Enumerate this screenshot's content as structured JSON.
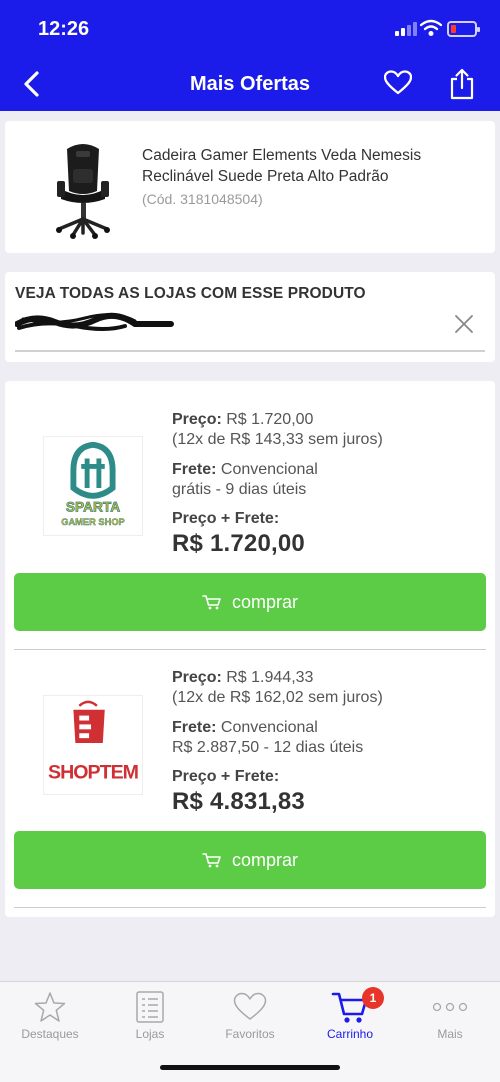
{
  "status_bar": {
    "time": "12:26"
  },
  "navbar": {
    "title": "Mais Ofertas"
  },
  "product": {
    "name": "Cadeira Gamer Elements Veda Nemesis Reclinável Suede Preta Alto Padrão",
    "code": "(Cód. 3181048504)"
  },
  "stores": {
    "title": "VEJA TODAS AS LOJAS COM ESSE PRODUTO"
  },
  "offers": [
    {
      "store_logo_text": [
        "SPARTA",
        "GAMER SHOP"
      ],
      "price_label": "Preço:",
      "price": "R$ 1.720,00",
      "installments": "(12x de R$ 143,33 sem juros)",
      "shipping_label": "Frete:",
      "shipping_type": "Convencional",
      "shipping_detail": "grátis - 9 dias úteis",
      "total_label": "Preço + Frete:",
      "total": "R$ 1.720,00",
      "buy_label": "comprar"
    },
    {
      "store_logo_text": [
        "SHOPTEM"
      ],
      "price_label": "Preço:",
      "price": "R$ 1.944,33",
      "installments": "(12x de R$ 162,02 sem juros)",
      "shipping_label": "Frete:",
      "shipping_type": "Convencional",
      "shipping_detail": "R$ 2.887,50 - 12 dias úteis",
      "total_label": "Preço + Frete:",
      "total": "R$ 4.831,83",
      "buy_label": "comprar"
    }
  ],
  "tabbar": {
    "items": [
      {
        "label": "Destaques",
        "icon": "star-icon"
      },
      {
        "label": "Lojas",
        "icon": "list-icon"
      },
      {
        "label": "Favoritos",
        "icon": "heart-icon"
      },
      {
        "label": "Carrinho",
        "icon": "cart-icon",
        "badge": "1",
        "active": true
      },
      {
        "label": "Mais",
        "icon": "more-icon"
      }
    ]
  },
  "colors": {
    "brand": "#1b1bea",
    "buy_button": "#5ccb46",
    "badge": "#e8352a"
  }
}
